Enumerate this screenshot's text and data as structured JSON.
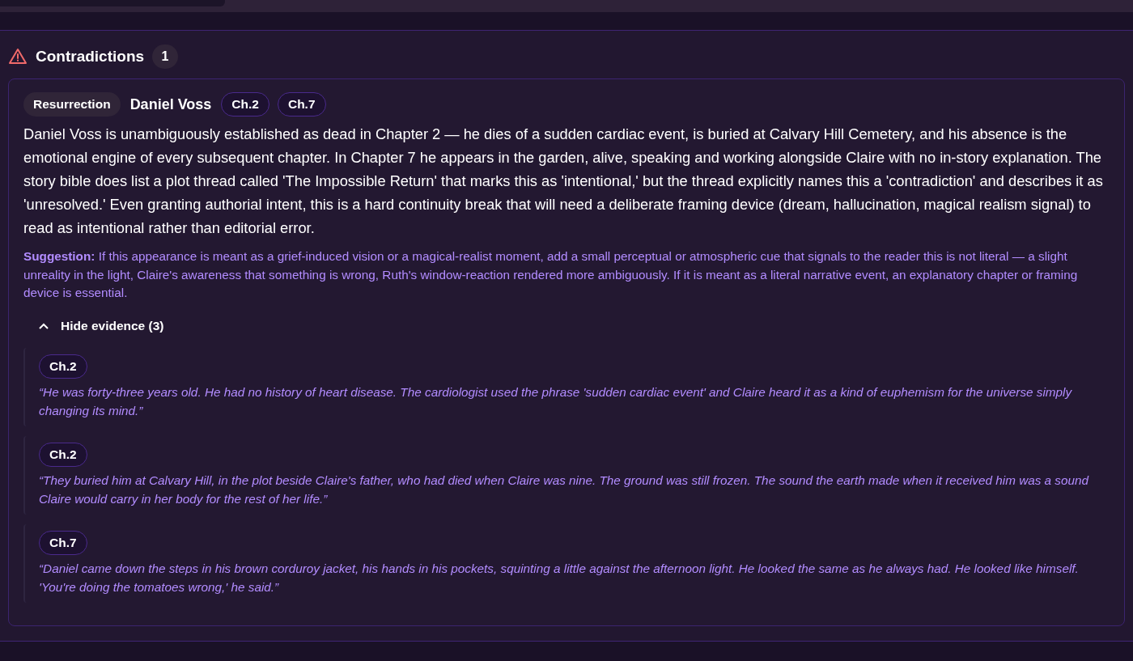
{
  "section": {
    "title": "Contradictions",
    "count": "1"
  },
  "issues": [
    {
      "tag": "Resurrection",
      "character": "Daniel Voss",
      "chapters": [
        "Ch.2",
        "Ch.7"
      ],
      "description": "Daniel Voss is unambiguously established as dead in Chapter 2 — he dies of a sudden cardiac event, is buried at Calvary Hill Cemetery, and his absence is the emotional engine of every subsequent chapter. In Chapter 7 he appears in the garden, alive, speaking and working alongside Claire with no in-story explanation. The story bible does list a plot thread called 'The Impossible Return' that marks this as 'intentional,' but the thread explicitly names this a 'contradiction' and describes it as 'unresolved.' Even granting authorial intent, this is a hard continuity break that will need a deliberate framing device (dream, hallucination, magical realism signal) to read as intentional rather than editorial error.",
      "suggestion": "**Suggestion:** If this appearance is meant as a grief-induced vision or a magical-realist moment, add a small perceptual or atmospheric cue that signals to the reader this is not literal — a slight unreality in the light, Claire's awareness that something is wrong, Ruth's window-reaction rendered more ambiguously. If it is meant as a literal narrative event, an explanatory chapter or framing device is essential.",
      "evidence_toggle": {
        "label": "Hide evidence (3)",
        "expanded": true
      },
      "evidence": [
        {
          "chapter": "Ch.2",
          "quote": "“He was forty-three years old. He had no history of heart disease. The cardiologist used the phrase 'sudden cardiac event' and Claire heard it as a kind of euphemism for the universe simply changing its mind.”"
        },
        {
          "chapter": "Ch.2",
          "quote": "“They buried him at Calvary Hill, in the plot beside Claire's father, who had died when Claire was nine. The ground was still frozen. The sound the earth made when it received him was a sound Claire would carry in her body for the rest of her life.”"
        },
        {
          "chapter": "Ch.7",
          "quote": "“Daniel came down the steps in his brown corduroy jacket, his hands in his pockets, squinting a little against the afternoon light. He looked the same as he always had. He looked like himself. 'You're doing the tomatoes wrong,' he said.”"
        }
      ]
    }
  ]
}
